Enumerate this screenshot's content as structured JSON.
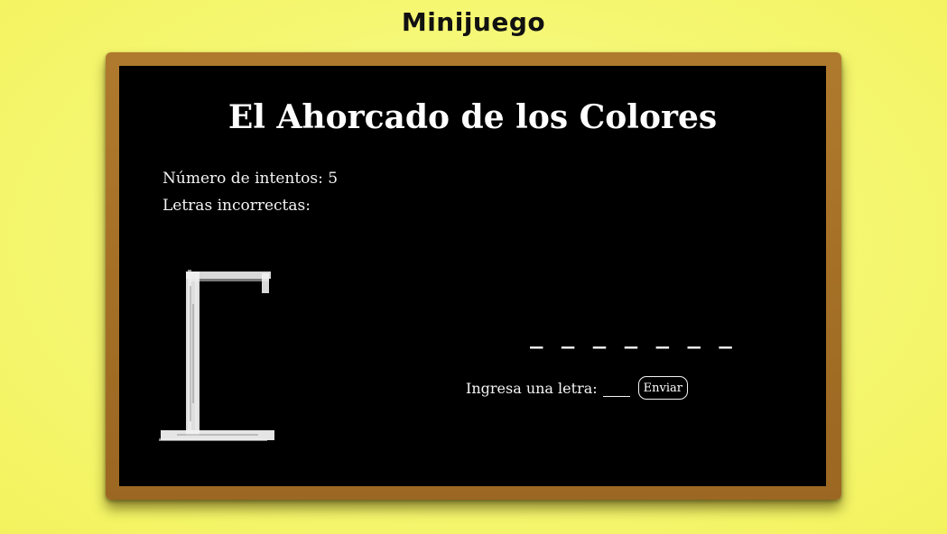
{
  "page": {
    "title": "Minijuego"
  },
  "game": {
    "title": "El Ahorcado de los Colores",
    "attempts_label": "Número de intentos: ",
    "attempts_value": "5",
    "wrong_letters_label": "Letras incorrectas:",
    "wrong_letters_value": "",
    "word_blanks": "_ _ _ _ _ _ _",
    "input_label": "Ingresa una letra:",
    "input_value": "",
    "send_button_label": "Enviar"
  },
  "colors": {
    "background": "#f5f772",
    "board": "#000000",
    "frame": "#a57026",
    "chalk": "#f4f4f4"
  },
  "icons": {
    "gallows": "gallows-icon"
  }
}
